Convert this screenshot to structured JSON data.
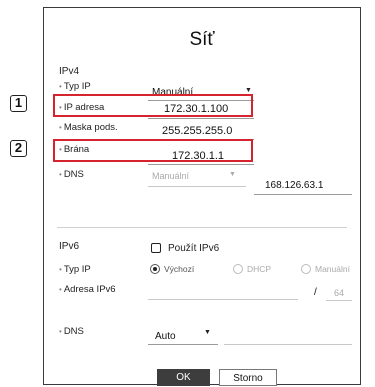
{
  "dialog": {
    "title": "Síť"
  },
  "callouts": [
    "1",
    "2"
  ],
  "ipv4": {
    "section_label": "IPv4",
    "typ_ip": {
      "label": "Typ IP",
      "value": "Manuální"
    },
    "ip_adresa": {
      "label": "IP adresa",
      "value": "172.30.1.100"
    },
    "maska": {
      "label": "Maska pods.",
      "value": "255.255.255.0"
    },
    "brana": {
      "label": "Brána",
      "value": "172.30.1.1"
    },
    "dns": {
      "label": "DNS",
      "mode": "Manuální",
      "value": "168.126.63.1"
    }
  },
  "ipv6": {
    "section_label": "IPv6",
    "use_checkbox_label": "Použít IPv6",
    "typ_ip": {
      "label": "Typ IP",
      "options": [
        "Výchozí",
        "DHCP",
        "Manuální"
      ],
      "selected": "Výchozí"
    },
    "adresa": {
      "label": "Adresa IPv6",
      "separator": "/",
      "prefix": "64"
    },
    "dns": {
      "label": "DNS",
      "value": "Auto"
    }
  },
  "buttons": {
    "ok": "OK",
    "cancel": "Storno"
  },
  "colors": {
    "highlight": "#d5242e",
    "ok_button": "#3d3d3d"
  }
}
